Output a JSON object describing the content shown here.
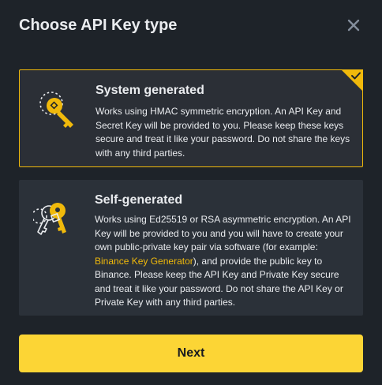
{
  "dialog": {
    "title": "Choose API Key type"
  },
  "options": [
    {
      "title": "System generated",
      "description": "Works using HMAC symmetric encryption. An API Key and Secret Key will be provided to you. Please keep these keys secure and treat it like your password. Do not share the keys with any third parties.",
      "selected": true
    },
    {
      "title": "Self-generated",
      "description_before_link": "Works using Ed25519 or RSA asymmetric encryption. An API Key will be provided to you and you will have to create your own public-private key pair via software (for example: ",
      "link_text": "Binance Key Generator",
      "description_after_link": "), and provide the public key to Binance. Please keep the API Key and Private Key secure and treat it like your password. Do not share the API Key or Private Key with any third parties.",
      "selected": false
    }
  ],
  "footer": {
    "next_label": "Next"
  },
  "icons": {
    "close": "close-icon",
    "check": "check-icon",
    "system_key": "key-icon",
    "self_keys": "keys-icon"
  },
  "colors": {
    "accent": "#f0b90b",
    "button": "#fcd535",
    "background": "#1e2329",
    "card": "#2b3139"
  }
}
